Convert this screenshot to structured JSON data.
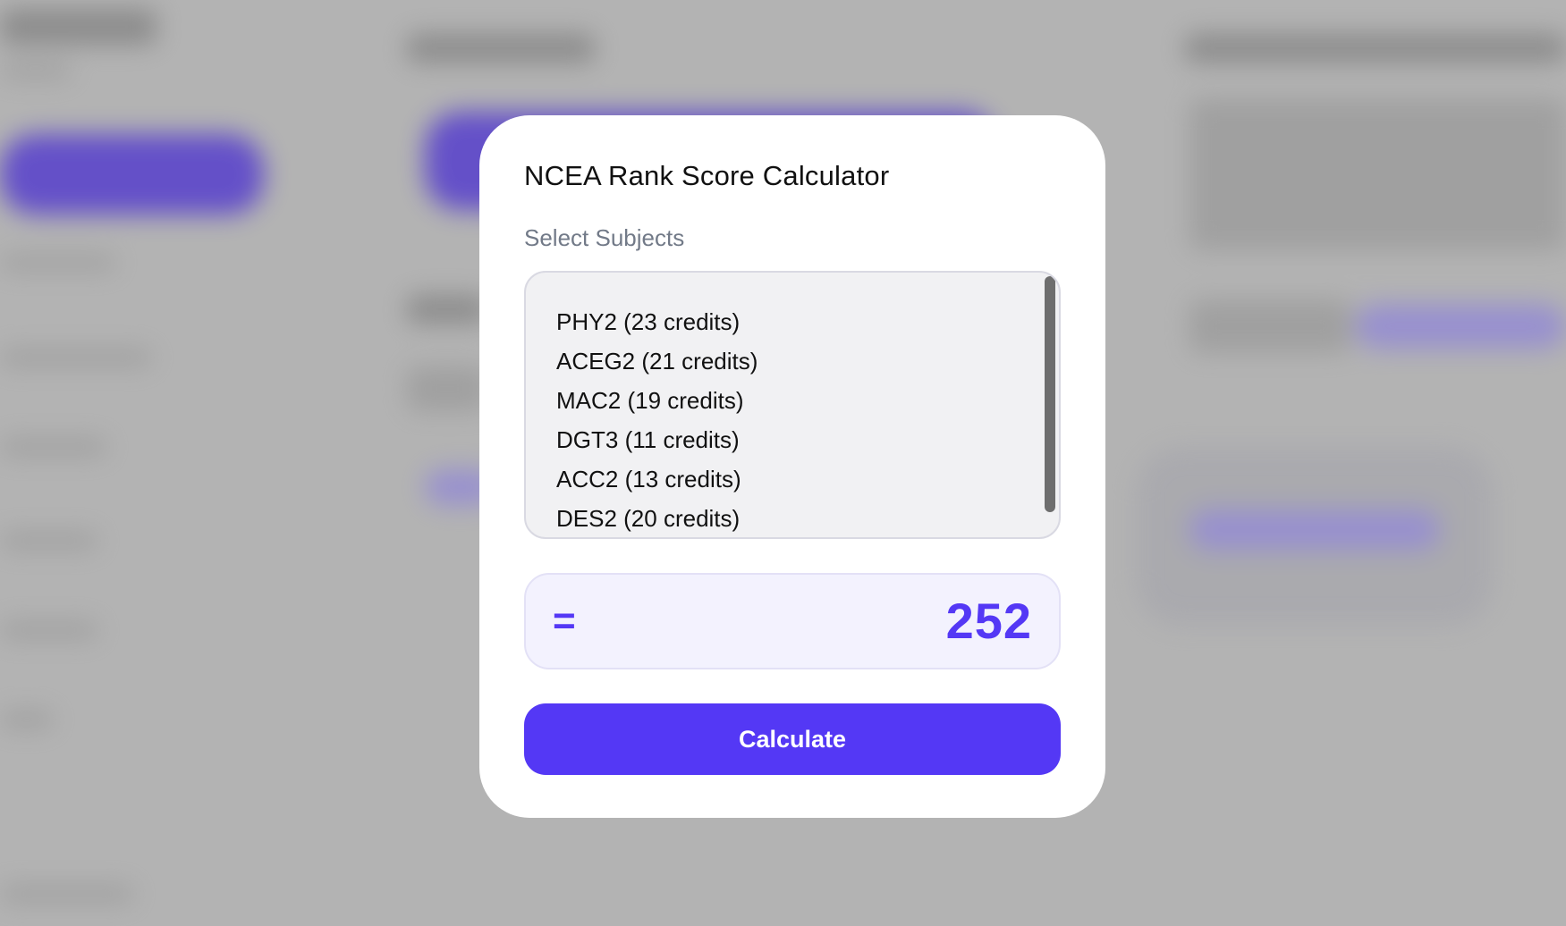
{
  "dialog": {
    "title": "NCEA Rank Score Calculator",
    "section_label": "Select Subjects",
    "subjects": [
      {
        "label": "PHY2 (23 credits)"
      },
      {
        "label": "ACEG2 (21 credits)"
      },
      {
        "label": "MAC2 (19 credits)"
      },
      {
        "label": "DGT3 (11 credits)"
      },
      {
        "label": "ACC2 (13 credits)"
      },
      {
        "label": "DES2 (20 credits)"
      }
    ],
    "result": {
      "symbol": "=",
      "value": "252"
    },
    "calculate_label": "Calculate"
  },
  "colors": {
    "accent": "#5438f5",
    "overlay": "#b3b3b3",
    "label_gray": "#727a88",
    "list_background": "#f1f1f3",
    "result_background": "#f3f2fe"
  }
}
